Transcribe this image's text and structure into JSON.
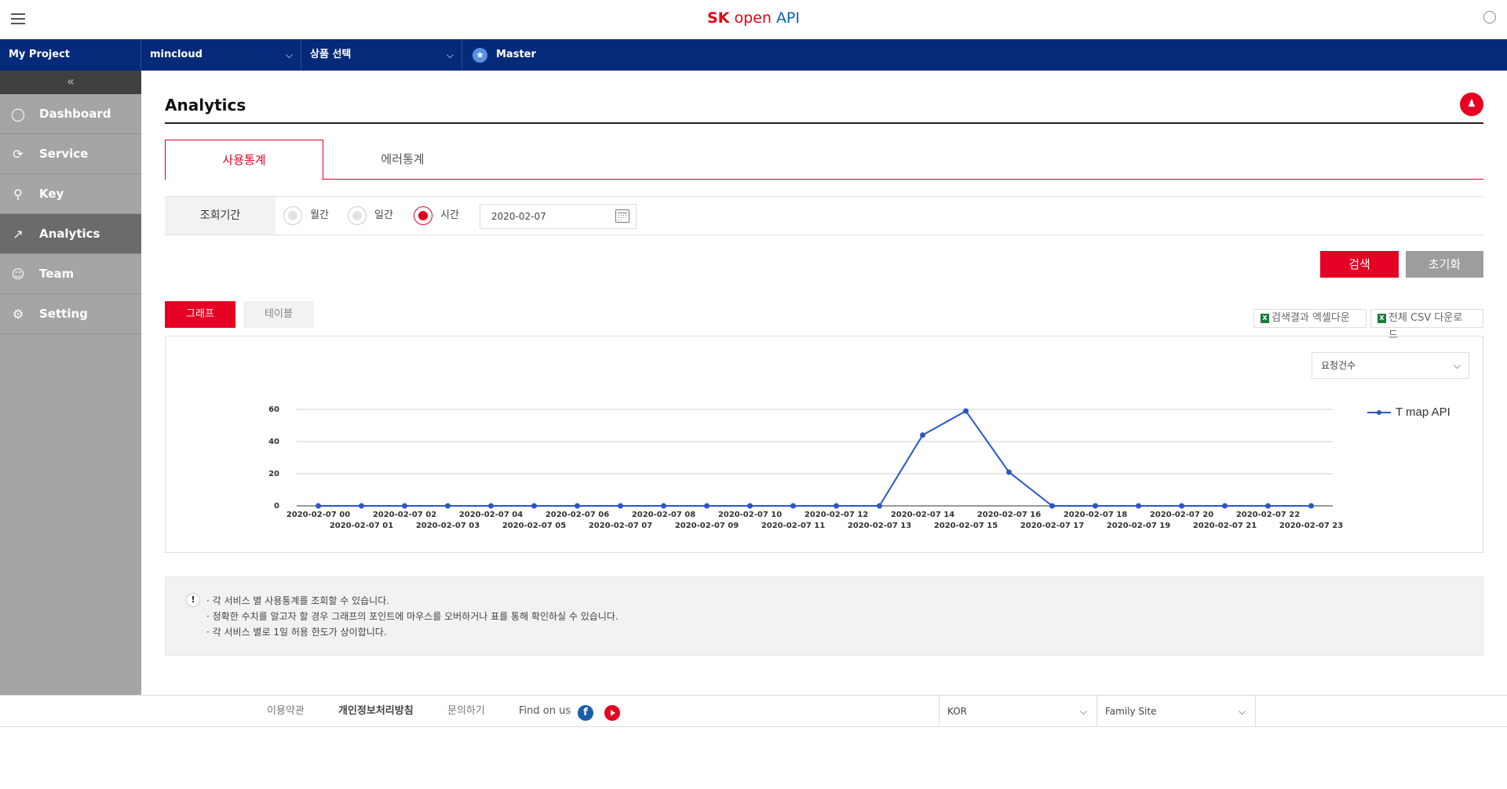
{
  "header": {
    "logo_sk": "SK",
    "logo_open": "open",
    "logo_api": "API"
  },
  "nav": {
    "project": "My Project",
    "cloud": "mincloud",
    "product": "상품 선택",
    "master": "Master"
  },
  "sidebar": {
    "items": [
      {
        "label": "Dashboard",
        "icon": "dashboard-icon"
      },
      {
        "label": "Service",
        "icon": "service-icon"
      },
      {
        "label": "Key",
        "icon": "key-icon"
      },
      {
        "label": "Analytics",
        "icon": "analytics-icon",
        "active": true
      },
      {
        "label": "Team",
        "icon": "team-icon"
      },
      {
        "label": "Setting",
        "icon": "gear-icon"
      }
    ]
  },
  "page": {
    "title": "Analytics"
  },
  "tabs": [
    {
      "label": "사용통계",
      "active": true
    },
    {
      "label": "에러통계"
    }
  ],
  "period": {
    "label": "조회기간",
    "options": [
      {
        "label": "월간"
      },
      {
        "label": "일간"
      },
      {
        "label": "시간",
        "selected": true
      }
    ],
    "date": "2020-02-07"
  },
  "actions": {
    "search": "검색",
    "reset": "초기화"
  },
  "view": {
    "graph": "그래프",
    "table": "테이블",
    "excel_download": "검색결과 엑셀다운",
    "csv_download": "전체 CSV 다운로드",
    "metric": "요청건수"
  },
  "chart_data": {
    "type": "line",
    "x": [
      "2020-02-07 00",
      "2020-02-07 01",
      "2020-02-07 02",
      "2020-02-07 03",
      "2020-02-07 04",
      "2020-02-07 05",
      "2020-02-07 06",
      "2020-02-07 07",
      "2020-02-07 08",
      "2020-02-07 09",
      "2020-02-07 10",
      "2020-02-07 11",
      "2020-02-07 12",
      "2020-02-07 13",
      "2020-02-07 14",
      "2020-02-07 15",
      "2020-02-07 16",
      "2020-02-07 17",
      "2020-02-07 18",
      "2020-02-07 19",
      "2020-02-07 20",
      "2020-02-07 21",
      "2020-02-07 22",
      "2020-02-07 23"
    ],
    "series": [
      {
        "name": "T map API",
        "color": "#2a57c8",
        "values": [
          0,
          0,
          0,
          0,
          0,
          0,
          0,
          0,
          0,
          0,
          0,
          0,
          0,
          0,
          44,
          59,
          21,
          0,
          0,
          0,
          0,
          0,
          0,
          0
        ]
      }
    ],
    "ylim": [
      0,
      60
    ],
    "yticks": [
      0,
      20,
      40,
      60
    ],
    "grid": true,
    "legend": "right"
  },
  "notice": {
    "lines": [
      "각 서비스 별 사용통계를 조회할 수 있습니다.",
      "정확한 수치를 알고자 할 경우 그래프의 포인트에 마우스를 오버하거나 표를 통해 확인하실 수 있습니다.",
      "각 서비스 별로 1일 허용 한도가 상이합니다."
    ]
  },
  "footer": {
    "terms": "이용약관",
    "privacy": "개인정보처리방침",
    "contact": "문의하기",
    "find_on": "Find on us",
    "language": "KOR",
    "family_site": "Family Site"
  }
}
